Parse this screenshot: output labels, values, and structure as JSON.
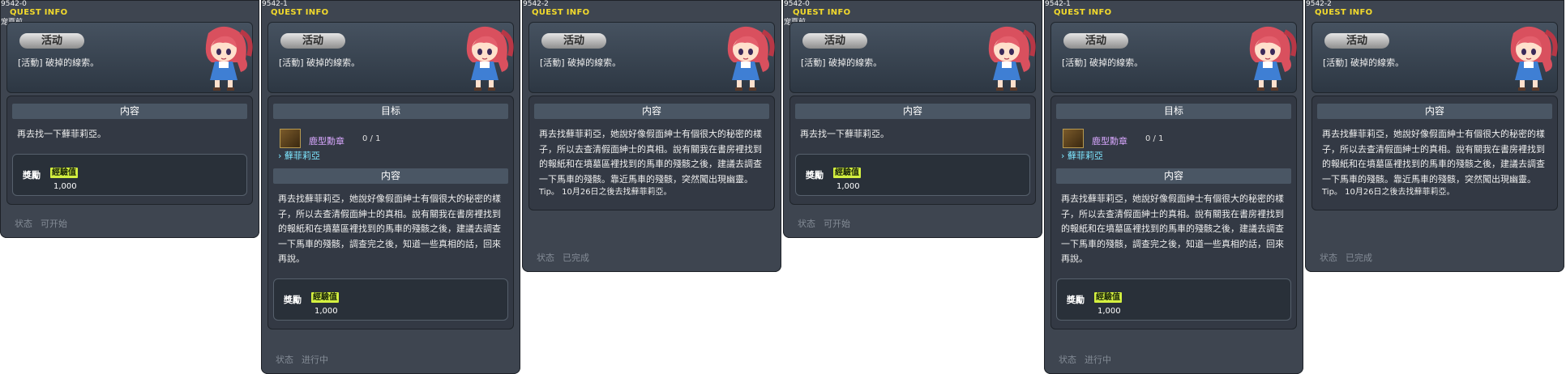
{
  "panels": [
    {
      "id": "9542-0",
      "subtitle": "宠夏前",
      "title": "QUEST INFO",
      "tag": "活动",
      "quest_name": "[活動] 破掉的線索。",
      "has_goal": false,
      "goal_header": "",
      "goal_item": "",
      "goal_count": "",
      "goal_npc": "",
      "content_header": "内容",
      "content": "再去找一下蘚菲莉亞。",
      "tip": "",
      "has_reward": true,
      "reward_label": "獎勵",
      "exp_label": "經驗值",
      "exp_value": "1,000",
      "status_label": "状态",
      "status_value": "可开始"
    },
    {
      "id": "9542-1",
      "subtitle": "",
      "title": "QUEST INFO",
      "tag": "活动",
      "quest_name": "[活動] 破掉的線索。",
      "has_goal": true,
      "goal_header": "目标",
      "goal_item": "鹿型勳章",
      "goal_count": "0 / 1",
      "goal_npc": "蘚菲莉亞",
      "content_header": "内容",
      "content": "再去找蘚菲莉亞，她說好像假面紳士有個很大的秘密的樣子，所以去查清假面紳士的真相。說有關我在書房裡找到的報紙和在墳墓區裡找到的馬車的殘骸之後，建議去調查一下馬車的殘骸，調查完之後，知道一些真相的話，回來再說。",
      "tip": "",
      "has_reward": true,
      "reward_label": "獎勵",
      "exp_label": "經驗值",
      "exp_value": "1,000",
      "status_label": "状态",
      "status_value": "进行中"
    },
    {
      "id": "9542-2",
      "subtitle": "",
      "title": "QUEST INFO",
      "tag": "活动",
      "quest_name": "[活動] 破掉的線索。",
      "has_goal": false,
      "goal_header": "",
      "goal_item": "",
      "goal_count": "",
      "goal_npc": "",
      "content_header": "内容",
      "content": "再去找蘚菲莉亞，她說好像假面紳士有個很大的秘密的樣子，所以去查清假面紳士的真相。說有關我在書房裡找到的報紙和在墳墓區裡找到的馬車的殘骸之後，建議去調查一下馬車的殘骸。靠近馬車的殘骸，突然闖出現幽靈。",
      "tip": "Tip。 10月26日之後去找蘚菲莉亞。",
      "has_reward": false,
      "reward_label": "",
      "exp_label": "",
      "exp_value": "",
      "status_label": "状态",
      "status_value": "已完成"
    },
    {
      "id": "9542-0",
      "subtitle": "宠夏前",
      "title": "QUEST INFO",
      "tag": "活动",
      "quest_name": "[活動] 破掉的線索。",
      "has_goal": false,
      "goal_header": "",
      "goal_item": "",
      "goal_count": "",
      "goal_npc": "",
      "content_header": "内容",
      "content": "再去找一下蘚菲莉亞。",
      "tip": "",
      "has_reward": true,
      "reward_label": "獎勵",
      "exp_label": "經驗值",
      "exp_value": "1,000",
      "status_label": "状态",
      "status_value": "可开始"
    },
    {
      "id": "9542-1",
      "subtitle": "",
      "title": "QUEST INFO",
      "tag": "活动",
      "quest_name": "[活動] 破掉的線索。",
      "has_goal": true,
      "goal_header": "目标",
      "goal_item": "鹿型勳章",
      "goal_count": "0 / 1",
      "goal_npc": "蘚菲莉亞",
      "content_header": "内容",
      "content": "再去找蘚菲莉亞，她說好像假面紳士有個很大的秘密的樣子，所以去查清假面紳士的真相。說有關我在書房裡找到的報紙和在墳墓區裡找到的馬車的殘骸之後，建議去調查一下馬車的殘骸，調查完之後，知道一些真相的話，回來再說。",
      "tip": "",
      "has_reward": true,
      "reward_label": "獎勵",
      "exp_label": "經驗值",
      "exp_value": "1,000",
      "status_label": "状态",
      "status_value": "进行中"
    },
    {
      "id": "9542-2",
      "subtitle": "",
      "title": "QUEST INFO",
      "tag": "活动",
      "quest_name": "[活動] 破掉的線索。",
      "has_goal": false,
      "goal_header": "",
      "goal_item": "",
      "goal_count": "",
      "goal_npc": "",
      "content_header": "内容",
      "content": "再去找蘚菲莉亞，她說好像假面紳士有個很大的秘密的樣子，所以去查清假面紳士的真相。說有關我在書房裡找到的報紙和在墳墓區裡找到的馬車的殘骸之後，建議去調查一下馬車的殘骸。靠近馬車的殘骸，突然闖出現幽靈。",
      "tip": "Tip。 10月26日之後去找蘚菲莉亞。",
      "has_reward": false,
      "reward_label": "",
      "exp_label": "",
      "exp_value": "",
      "status_label": "状态",
      "status_value": "已完成"
    }
  ]
}
